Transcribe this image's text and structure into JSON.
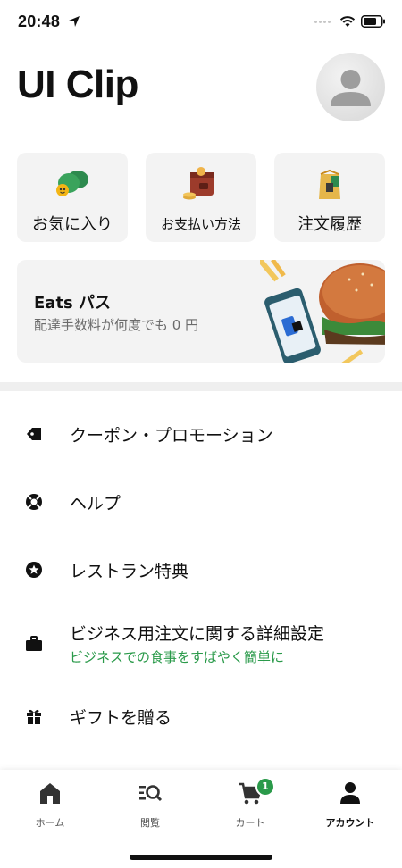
{
  "status_bar": {
    "time": "20:48"
  },
  "header": {
    "title": "UI Clip"
  },
  "tiles": [
    {
      "label": "お気に入り",
      "icon": "favorites-icon"
    },
    {
      "label": "お支払い方法",
      "icon": "wallet-icon"
    },
    {
      "label": "注文履歴",
      "icon": "bag-icon"
    }
  ],
  "eats_pass": {
    "title": "Eats パス",
    "subtitle": "配達手数料が何度でも 0 円"
  },
  "menu": [
    {
      "label": "クーポン・プロモーション",
      "icon": "tag-icon"
    },
    {
      "label": "ヘルプ",
      "icon": "lifebuoy-icon"
    },
    {
      "label": "レストラン特典",
      "icon": "star-badge-icon"
    },
    {
      "label": "ビジネス用注文に関する詳細設定",
      "sub": "ビジネスでの食事をすばやく簡単に",
      "icon": "briefcase-icon"
    },
    {
      "label": "ギフトを贈る",
      "icon": "gift-icon"
    }
  ],
  "tabbar": {
    "tabs": [
      {
        "label": "ホーム",
        "icon": "home-icon"
      },
      {
        "label": "閲覧",
        "icon": "browse-icon"
      },
      {
        "label": "カート",
        "icon": "cart-icon",
        "badge": "1"
      },
      {
        "label": "アカウント",
        "icon": "account-icon",
        "active": true
      }
    ]
  },
  "colors": {
    "accent_green": "#2a9a4a",
    "tile_bg": "#f3f3f3"
  }
}
